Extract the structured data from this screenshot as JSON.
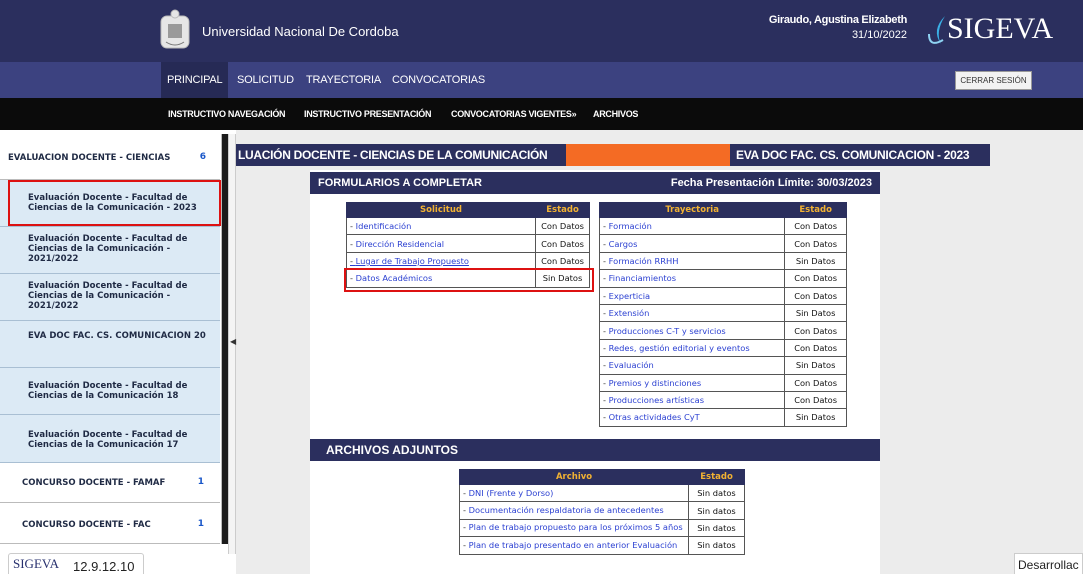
{
  "header": {
    "university": "Universidad Nacional De Cordoba",
    "user_name": "Giraudo, Agustina Elizabeth",
    "date": "31/10/2022",
    "logo": "SIGEVA",
    "logout": "CERRAR SESIÓN"
  },
  "nav": [
    "PRINCIPAL",
    "SOLICITUD",
    "TRAYECTORIA",
    "CONVOCATORIAS"
  ],
  "subnav": [
    "INSTRUCTIVO NAVEGACIÓN",
    "INSTRUCTIVO PRESENTACIÓN",
    "CONVOCATORIAS VIGENTES»",
    "ARCHIVOS"
  ],
  "sidebar": {
    "group1": {
      "label": "EVALUACION DOCENTE - CIENCIAS",
      "count": "6"
    },
    "items": [
      "Evaluación Docente - Facultad de Ciencias de la Comunicación - 2023",
      "Evaluación Docente - Facultad de Ciencias de la Comunicación - 2021/2022",
      "Evaluación Docente - Facultad de Ciencias de la Comunicación - 2021/2022",
      "EVA DOC FAC. CS. COMUNICACION 20",
      "Evaluación Docente - Facultad de Ciencias de la Comunicación 18",
      "Evaluación Docente - Facultad de Ciencias de la Comunicación 17"
    ],
    "group2": {
      "label": "CONCURSO DOCENTE - FAMAF",
      "count": "1"
    },
    "group3": {
      "label": "CONCURSO DOCENTE - FAC",
      "count": "1"
    }
  },
  "banner": {
    "left": "LUACIÓN DOCENTE - CIENCIAS DE LA COMUNICACIÓN",
    "right": "EVA DOC FAC. CS. COMUNICACION - 2023"
  },
  "forms": {
    "title": "FORMULARIOS A COMPLETAR",
    "deadline": "Fecha Presentación Límite: 30/03/2023",
    "solicitud_header": "Solicitud",
    "trayectoria_header": "Trayectoria",
    "estado_header": "Estado",
    "solicitud": [
      {
        "label": "Identificación",
        "state": "Con Datos"
      },
      {
        "label": "Dirección Residencial",
        "state": "Con Datos"
      },
      {
        "label": "Lugar de Trabajo Propuesto",
        "state": "Con Datos"
      },
      {
        "label": "Datos Académicos",
        "state": "Sin Datos"
      }
    ],
    "trayectoria": [
      {
        "label": "Formación",
        "state": "Con Datos"
      },
      {
        "label": "Cargos",
        "state": "Con Datos"
      },
      {
        "label": "Formación RRHH",
        "state": "Sin Datos"
      },
      {
        "label": "Financiamientos",
        "state": "Con Datos"
      },
      {
        "label": "Experticia",
        "state": "Con Datos"
      },
      {
        "label": "Extensión",
        "state": "Sin Datos"
      },
      {
        "label": "Producciones C-T y servicios",
        "state": "Con Datos"
      },
      {
        "label": "Redes, gestión editorial y eventos",
        "state": "Con Datos"
      },
      {
        "label": "Evaluación",
        "state": "Sin Datos"
      },
      {
        "label": "Premios y distinciones",
        "state": "Con Datos"
      },
      {
        "label": "Producciones artísticas",
        "state": "Con Datos"
      },
      {
        "label": "Otras actividades CyT",
        "state": "Sin Datos"
      }
    ]
  },
  "attachments": {
    "title": "ARCHIVOS ADJUNTOS",
    "archivo_header": "Archivo",
    "estado_header": "Estado",
    "rows": [
      {
        "label": "DNI (Frente y Dorso)",
        "state": "Sin datos"
      },
      {
        "label": "Documentación respaldatoria de antecedentes",
        "state": "Sin datos"
      },
      {
        "label": "Plan de trabajo propuesto para los próximos 5 años",
        "state": "Sin datos"
      },
      {
        "label": "Plan de trabajo presentado en anterior Evaluación",
        "state": "Sin datos"
      }
    ]
  },
  "footer": {
    "logo": "SIGEVA",
    "version": "12.9.12.10",
    "dev_tab": "Desarrollac"
  }
}
